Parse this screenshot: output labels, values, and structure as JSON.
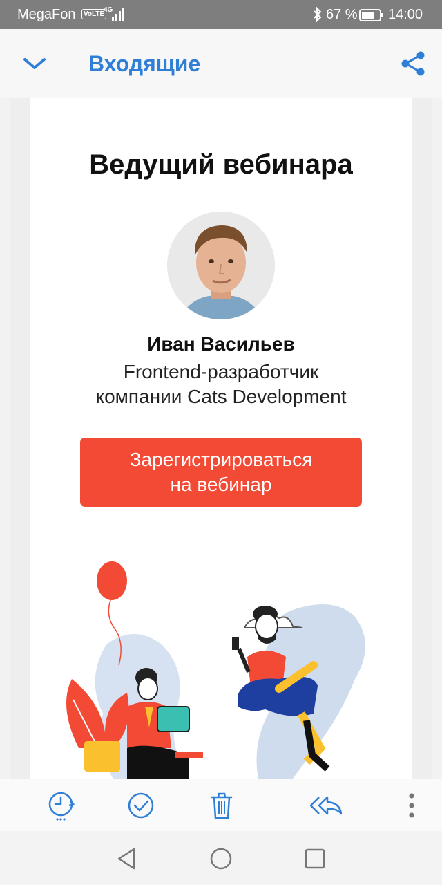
{
  "status_bar": {
    "carrier": "MegaFon",
    "volte": "VoLTE",
    "network": "4G",
    "battery_percent": "67 %",
    "time": "14:00"
  },
  "header": {
    "title": "Входящие",
    "icons": [
      "chevron-down-icon",
      "share-icon"
    ]
  },
  "email": {
    "heading": "Ведущий вебинара",
    "speaker_name": "Иван Васильев",
    "speaker_role_line1": "Frontend-разработчик",
    "speaker_role_line2": "компании Cats Development",
    "cta_line1": "Зарегистрироваться",
    "cta_line2": "на вебинар"
  },
  "toolbar": {
    "icons": [
      "snooze-icon",
      "mark-done-icon",
      "trash-icon",
      "reply-all-icon",
      "more-icon"
    ]
  },
  "navbar": {
    "icons": [
      "back-triangle-icon",
      "home-circle-icon",
      "recents-square-icon"
    ]
  },
  "colors": {
    "accent": "#2f7fd6",
    "cta": "#f24a35",
    "status_bar": "#7e7e7e"
  }
}
